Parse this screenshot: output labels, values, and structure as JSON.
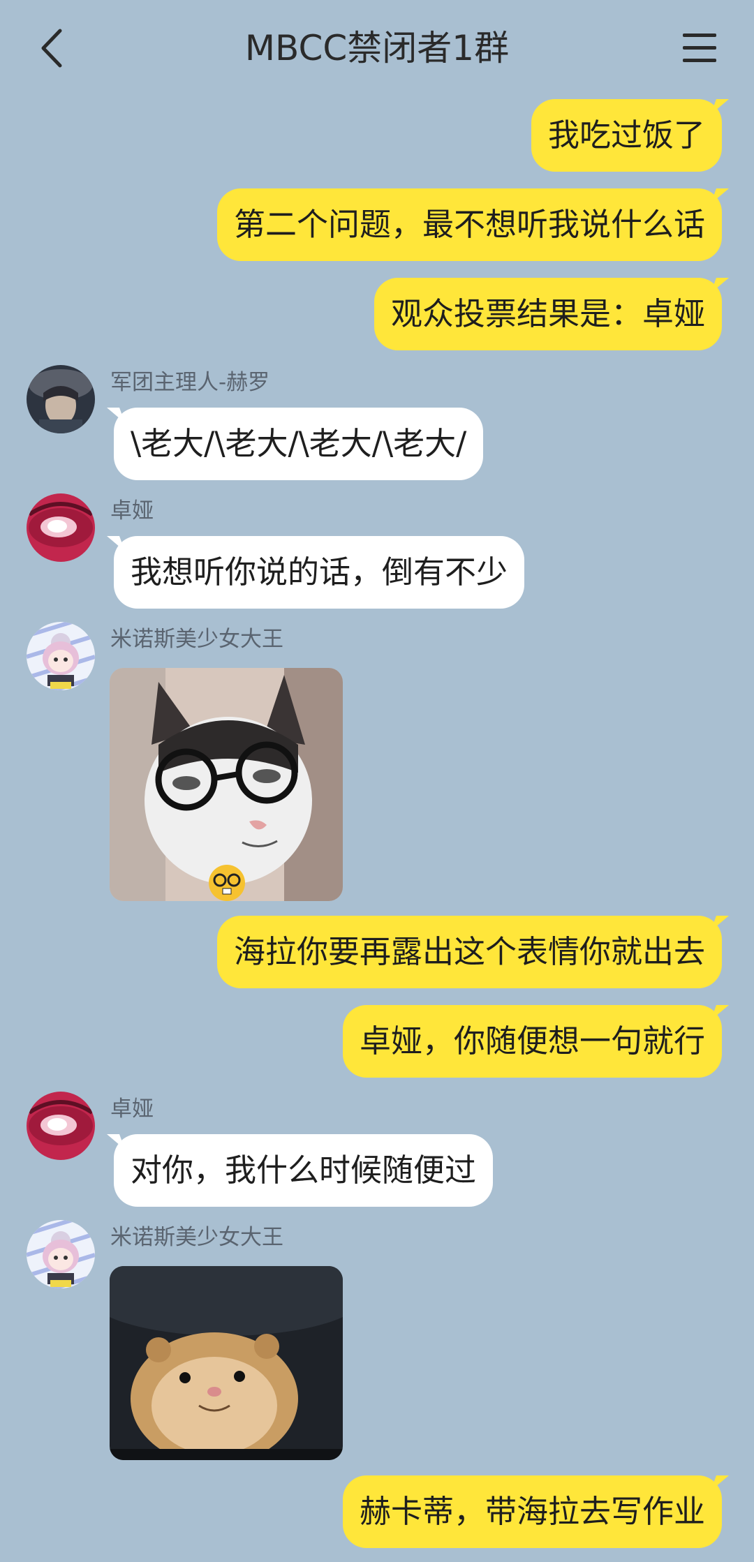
{
  "header": {
    "title": "MBCC禁闭者1群"
  },
  "icons": {
    "back": "chevron-left-icon",
    "menu": "hamburger-menu-icon"
  },
  "colors": {
    "background": "#a9bfd1",
    "self_bubble": "#ffe63a",
    "other_bubble": "#ffffff"
  },
  "messages": [
    {
      "side": "self",
      "text": "我吃过饭了"
    },
    {
      "side": "self",
      "text": "第二个问题，最不想听我说什么话"
    },
    {
      "side": "self",
      "text": "观众投票结果是：卓娅"
    },
    {
      "side": "other",
      "sender": "军团主理人-赫罗",
      "text": "\\老大/\\老大/\\老大/\\老大/"
    },
    {
      "side": "other",
      "sender": "卓娅",
      "text": "我想听你说的话，倒有不少"
    },
    {
      "side": "other",
      "sender": "米诺斯美少女大王",
      "image": "cat-with-glasses-sticker"
    },
    {
      "side": "self",
      "text": "海拉你要再露出这个表情你就出去"
    },
    {
      "side": "self",
      "text": "卓娅，你随便想一句就行"
    },
    {
      "side": "other",
      "sender": "卓娅",
      "text": "对你，我什么时候随便过"
    },
    {
      "side": "other",
      "sender": "米诺斯美少女大王",
      "image": "smiling-hamster-sticker"
    },
    {
      "side": "self",
      "text": "赫卡蒂，带海拉去写作业"
    }
  ]
}
